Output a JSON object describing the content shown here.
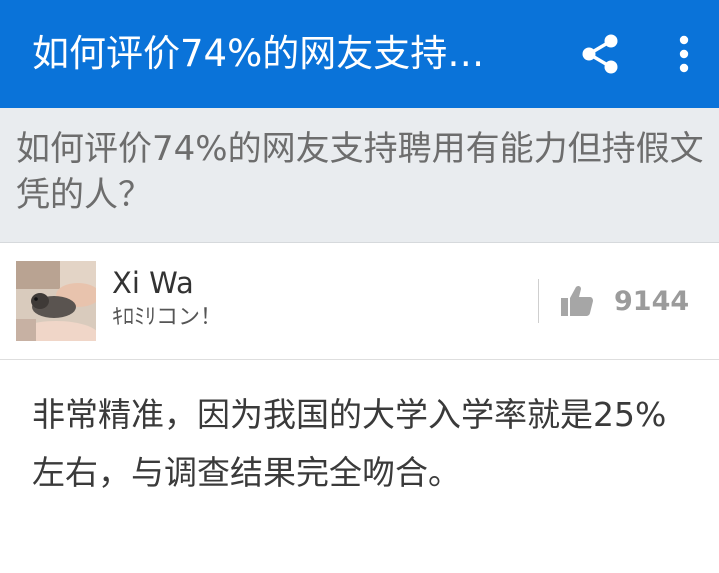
{
  "appbar": {
    "title": "如何评价74%的网友支持…",
    "background": "#0a73d9",
    "share_icon": "share-icon",
    "more_icon": "more-vertical-icon"
  },
  "question": {
    "title": "如何评价74%的网友支持聘用有能力但持假文凭的人？"
  },
  "author": {
    "name": "Xi Wa",
    "bio": "ｷﾛﾐﾘコン！",
    "avatar_icon": "avatar"
  },
  "vote": {
    "icon": "thumbs-up-icon",
    "count": "9144"
  },
  "answer": {
    "text": "非常精准，因为我国的大学入学率就是25%左右，与调查结果完全吻合。"
  }
}
